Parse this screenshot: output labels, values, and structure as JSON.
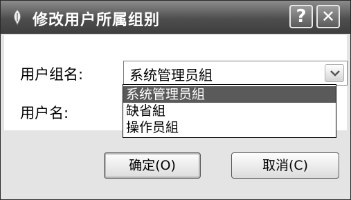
{
  "dialog": {
    "title": "修改用户所属组别",
    "help_label": "?",
    "close_label": "✕"
  },
  "form": {
    "group_label": "用户组名:",
    "user_label": "用户名:",
    "group_value": "系统管理员組",
    "dropdown_options": [
      "系统管理员組",
      "缺省組",
      "操作员組"
    ],
    "selected_index": 0
  },
  "buttons": {
    "ok_label": "确定(O)",
    "cancel_label": "取消(C)"
  },
  "icons": {
    "app": "app-icon",
    "dropdown": "chevron-down-icon"
  }
}
